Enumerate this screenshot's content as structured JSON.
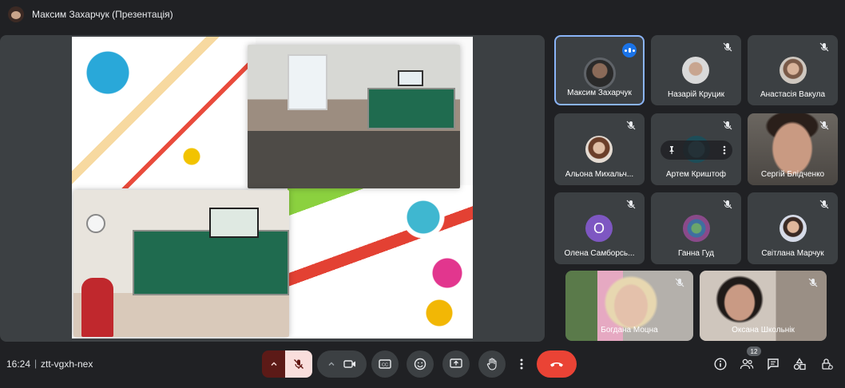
{
  "header": {
    "presenter_title": "Максим Захарчук (Презентація)"
  },
  "participants": [
    {
      "name": "Максим Захарчук",
      "state": "speaking"
    },
    {
      "name": "Назарій Круцик",
      "state": "muted"
    },
    {
      "name": "Анастасія Вакула",
      "state": "muted"
    },
    {
      "name": "Альона Михальч...",
      "state": "muted"
    },
    {
      "name": "Артем Криштоф",
      "state": "muted"
    },
    {
      "name": "Сергій Блідченко",
      "state": "muted"
    },
    {
      "name": "Олена Самборсь...",
      "state": "muted",
      "initial": "O"
    },
    {
      "name": "Ганна Гуд",
      "state": "muted"
    },
    {
      "name": "Світлана Марчук",
      "state": "muted"
    },
    {
      "name": "Богдана Моцна",
      "state": "muted"
    },
    {
      "name": "Оксана Школьнік",
      "state": "muted"
    }
  ],
  "footer": {
    "time": "16:24",
    "separator": "|",
    "meeting_code": "ztt-vgxh-nex",
    "people_count": "12"
  },
  "icons": {
    "mic": "mic-off-icon",
    "camera": "camera-icon",
    "captions": "captions-icon",
    "emoji": "emoji-icon",
    "present": "present-screen-icon",
    "hand": "raise-hand-icon",
    "more": "more-options-icon",
    "hangup": "hang-up-icon",
    "info": "info-icon",
    "people": "people-icon",
    "chat": "chat-icon",
    "activities": "activities-icon",
    "host": "host-controls-icon"
  },
  "colors": {
    "background": "#202124",
    "tile": "#3c4043",
    "active_border": "#8ab4f8",
    "hangup": "#ea4335",
    "mic_muted_bg": "#f9dedc",
    "speaking": "#1a73e8"
  }
}
